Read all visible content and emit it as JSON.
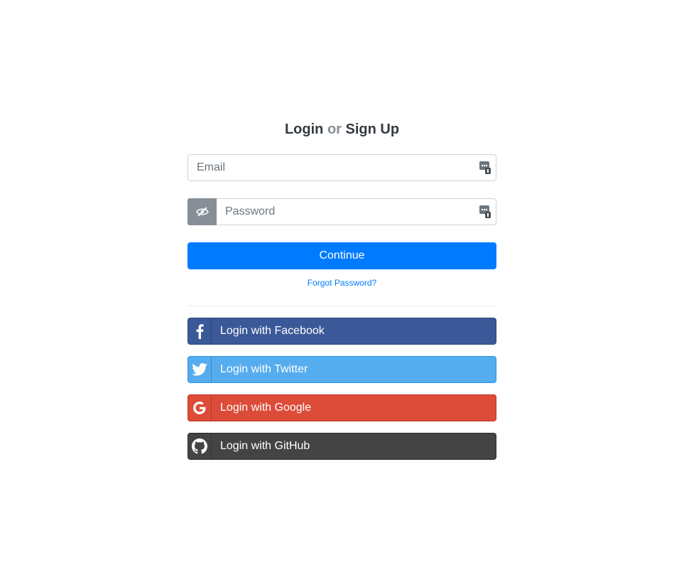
{
  "heading": {
    "login": "Login",
    "or": "or",
    "signup": "Sign Up"
  },
  "email": {
    "placeholder": "Email",
    "value": ""
  },
  "password": {
    "placeholder": "Password",
    "value": ""
  },
  "continue_label": "Continue",
  "forgot_label": "Forgot Password?",
  "social": [
    {
      "label": "Login with Facebook",
      "icon": "facebook-icon",
      "color": "#3b5998"
    },
    {
      "label": "Login with Twitter",
      "icon": "twitter-icon",
      "color": "#55acee"
    },
    {
      "label": "Login with Google",
      "icon": "google-icon",
      "color": "#dd4b39"
    },
    {
      "label": "Login with GitHub",
      "icon": "github-icon",
      "color": "#444444"
    }
  ],
  "colors": {
    "primary": "#007bff",
    "muted": "#868e96"
  }
}
